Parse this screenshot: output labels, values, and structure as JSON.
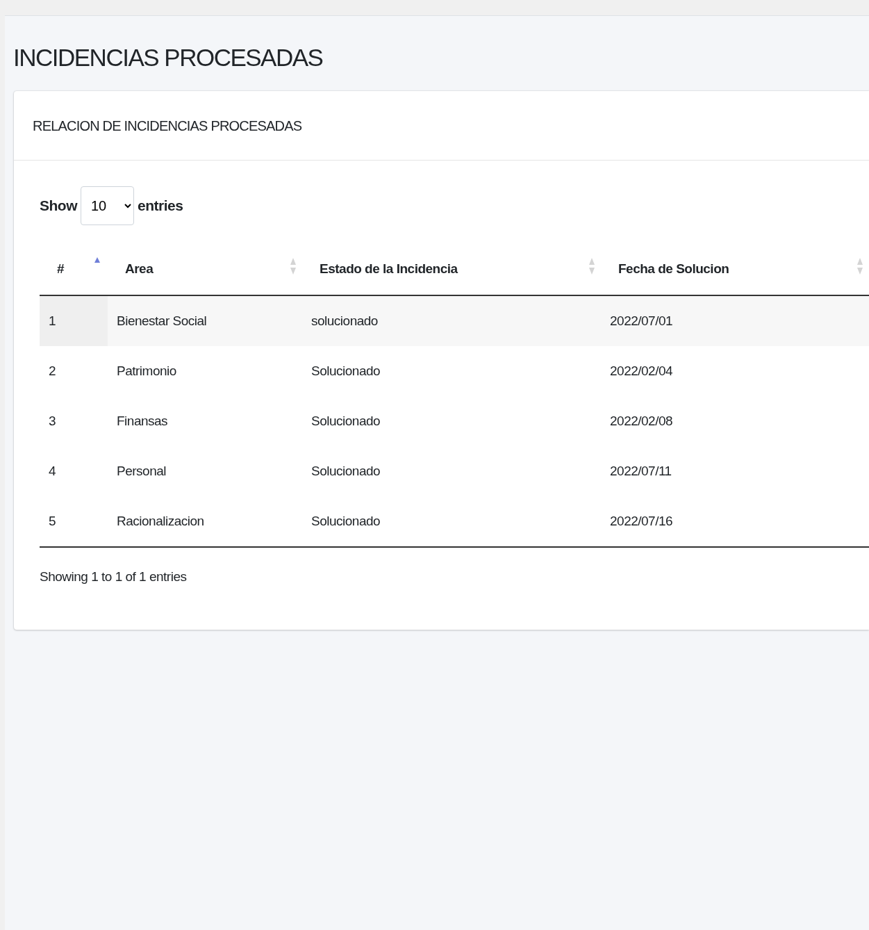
{
  "page_title": "INCIDENCIAS PROCESADAS",
  "card": {
    "title": "RELACION DE INCIDENCIAS PROCESADAS",
    "length_menu": {
      "show_label": "Show",
      "value": "10",
      "entries_label": "entries"
    },
    "table": {
      "columns": [
        {
          "label": "#",
          "sorted": true
        },
        {
          "label": "Area",
          "sorted": false
        },
        {
          "label": "Estado de la Incidencia",
          "sorted": false
        },
        {
          "label": "Fecha de Solucion",
          "sorted": false
        }
      ],
      "rows": [
        {
          "cells": [
            "1",
            "Bienestar Social",
            "solucionado",
            "2022/07/01"
          ],
          "highlighted": true
        },
        {
          "cells": [
            "2",
            "Patrimonio",
            "Solucionado",
            "2022/02/04"
          ],
          "highlighted": false
        },
        {
          "cells": [
            "3",
            "Finansas",
            "Solucionado",
            "2022/02/08"
          ],
          "highlighted": false
        },
        {
          "cells": [
            "4",
            "Personal",
            "Solucionado",
            "2022/07/11"
          ],
          "highlighted": false
        },
        {
          "cells": [
            "5",
            "Racionalizacion",
            "Solucionado",
            "2022/07/16"
          ],
          "highlighted": false
        }
      ]
    },
    "info": "Showing 1 to 1 of 1 entries"
  }
}
